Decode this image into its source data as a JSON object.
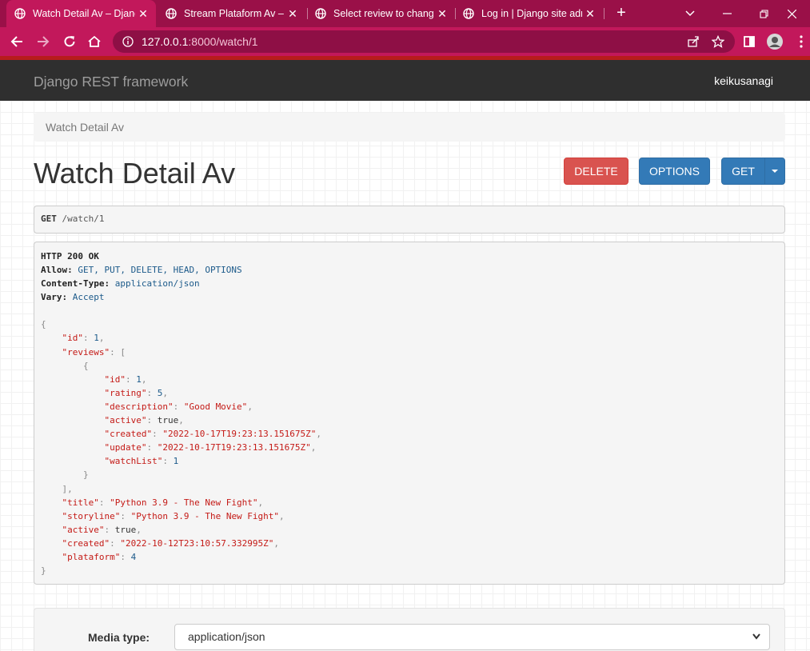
{
  "browser": {
    "tabs": [
      {
        "title": "Watch Detail Av – Django REST framework",
        "active": true
      },
      {
        "title": "Stream Plataform Av – Django REST framework",
        "active": false
      },
      {
        "title": "Select review to change | Django site admin",
        "active": false
      },
      {
        "title": "Log in | Django site admin",
        "active": false
      }
    ],
    "url_host": "127.0.0.1",
    "url_rest": ":8000/watch/1",
    "colors": {
      "tab_strip": "#9a1048",
      "toolbar": "#c2185b"
    }
  },
  "navbar": {
    "brand": "Django REST framework",
    "user": "keikusanagi"
  },
  "breadcrumb": "Watch Detail Av",
  "page": {
    "title": "Watch Detail Av",
    "buttons": {
      "delete": "DELETE",
      "options": "OPTIONS",
      "get": "GET"
    }
  },
  "request": {
    "method": "GET",
    "path": "/watch/1"
  },
  "response": {
    "status": "HTTP 200 OK",
    "headers": [
      {
        "key": "Allow:",
        "value": "GET, PUT, DELETE, HEAD, OPTIONS"
      },
      {
        "key": "Content-Type:",
        "value": "application/json"
      },
      {
        "key": "Vary:",
        "value": "Accept"
      }
    ],
    "body": {
      "id": "1",
      "review": {
        "id": "1",
        "rating": "5",
        "description": "\"Good Movie\"",
        "active": "true",
        "created": "\"2022-10-17T19:23:13.151675Z\"",
        "update": "\"2022-10-17T19:23:13.151675Z\"",
        "watchList": "1"
      },
      "title": "\"Python 3.9 - The New Fight\"",
      "storyline": "\"Python 3.9 - The New Fight\"",
      "active": "true",
      "created": "\"2022-10-12T23:10:57.332995Z\"",
      "plataform": "4"
    }
  },
  "media_form": {
    "label": "Media type:",
    "selected": "application/json"
  }
}
